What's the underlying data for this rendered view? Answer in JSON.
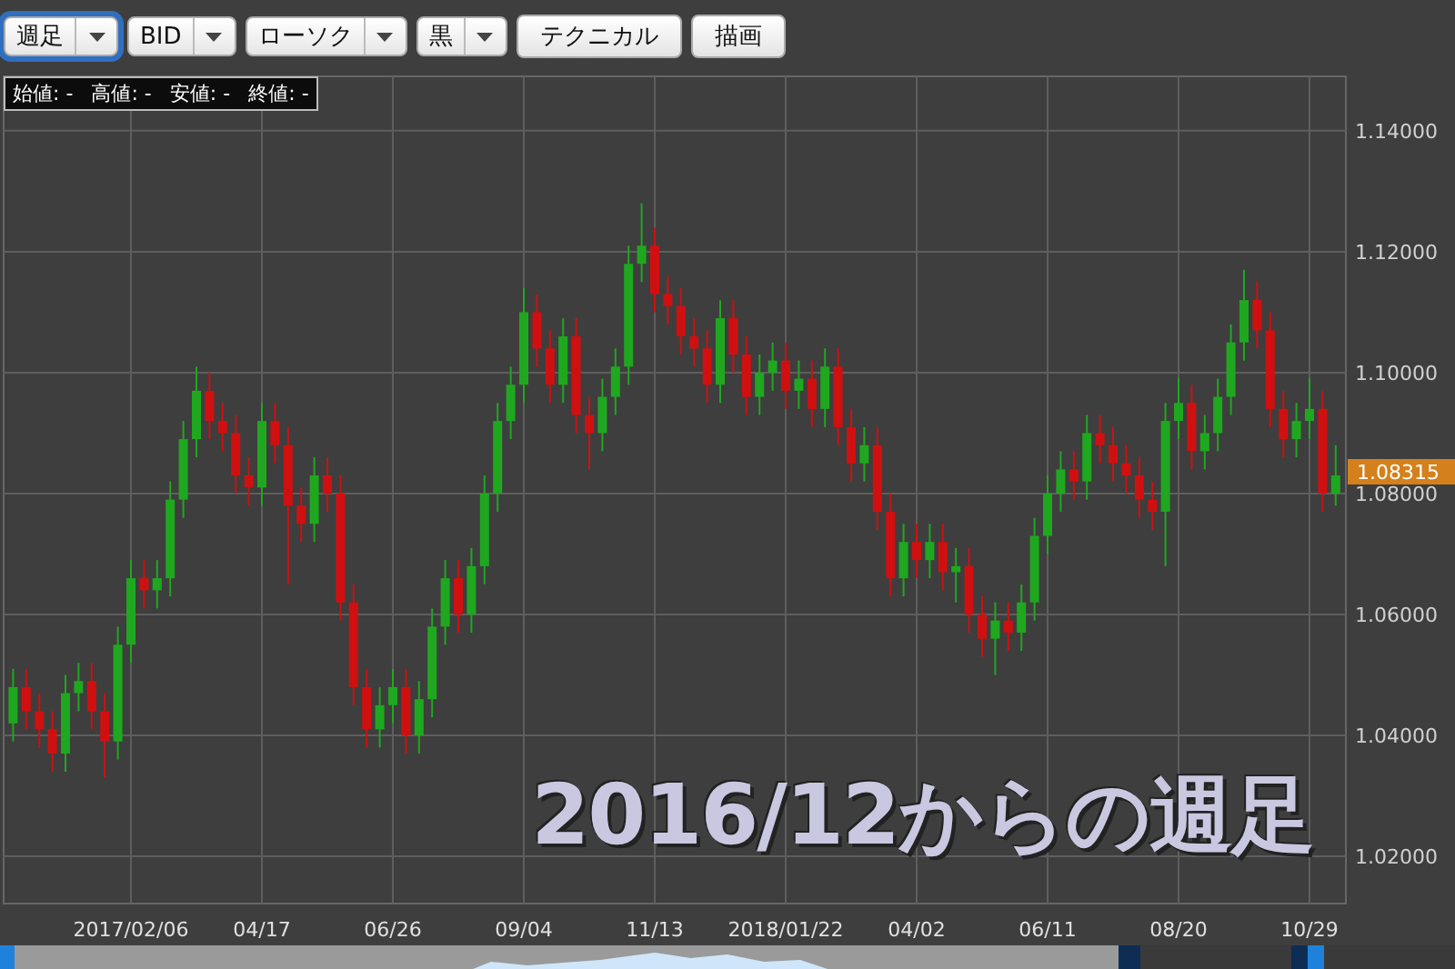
{
  "toolbar": {
    "selects": [
      {
        "value": "週足",
        "focused": true
      },
      {
        "value": "BID",
        "focused": false
      },
      {
        "value": "ローソク",
        "focused": false
      },
      {
        "value": "黒",
        "focused": false
      }
    ],
    "buttons": [
      "テクニカル",
      "描画"
    ]
  },
  "ohlc_legend": [
    {
      "label": "始値:",
      "value": "-"
    },
    {
      "label": "高値:",
      "value": "-"
    },
    {
      "label": "安値:",
      "value": "-"
    },
    {
      "label": "終値:",
      "value": "-"
    }
  ],
  "chart": {
    "current_price": "1.08315",
    "chart_data": {
      "type": "candlestick",
      "categories": [
        null,
        null,
        null,
        null,
        null,
        null,
        null,
        null,
        null,
        "2017/02/06",
        null,
        null,
        null,
        null,
        null,
        null,
        null,
        null,
        null,
        "04/17",
        null,
        null,
        null,
        null,
        null,
        null,
        null,
        null,
        null,
        "06/26",
        null,
        null,
        null,
        null,
        null,
        null,
        null,
        null,
        null,
        "09/04",
        null,
        null,
        null,
        null,
        null,
        null,
        null,
        null,
        null,
        "11/13",
        null,
        null,
        null,
        null,
        null,
        null,
        null,
        null,
        null,
        "2018/01/22",
        null,
        null,
        null,
        null,
        null,
        null,
        null,
        null,
        null,
        "04/02",
        null,
        null,
        null,
        null,
        null,
        null,
        null,
        null,
        null,
        "06/11",
        null,
        null,
        null,
        null,
        null,
        null,
        null,
        null,
        null,
        "08/20",
        null,
        null,
        null,
        null,
        null,
        null,
        null,
        null,
        null,
        "10/29",
        null,
        null
      ],
      "ohlc": [
        [
          1.042,
          1.051,
          1.039,
          1.048
        ],
        [
          1.048,
          1.051,
          1.041,
          1.044
        ],
        [
          1.044,
          1.047,
          1.038,
          1.041
        ],
        [
          1.041,
          1.044,
          1.034,
          1.037
        ],
        [
          1.037,
          1.05,
          1.034,
          1.047
        ],
        [
          1.047,
          1.052,
          1.044,
          1.049
        ],
        [
          1.049,
          1.052,
          1.041,
          1.044
        ],
        [
          1.044,
          1.047,
          1.033,
          1.039
        ],
        [
          1.039,
          1.058,
          1.036,
          1.055
        ],
        [
          1.055,
          1.069,
          1.052,
          1.066
        ],
        [
          1.066,
          1.069,
          1.061,
          1.064
        ],
        [
          1.064,
          1.069,
          1.061,
          1.066
        ],
        [
          1.066,
          1.082,
          1.063,
          1.079
        ],
        [
          1.079,
          1.092,
          1.076,
          1.089
        ],
        [
          1.089,
          1.101,
          1.086,
          1.097
        ],
        [
          1.097,
          1.1,
          1.089,
          1.092
        ],
        [
          1.092,
          1.095,
          1.087,
          1.09
        ],
        [
          1.09,
          1.093,
          1.08,
          1.083
        ],
        [
          1.083,
          1.086,
          1.078,
          1.081
        ],
        [
          1.081,
          1.095,
          1.078,
          1.092
        ],
        [
          1.092,
          1.095,
          1.085,
          1.088
        ],
        [
          1.088,
          1.091,
          1.065,
          1.078
        ],
        [
          1.078,
          1.081,
          1.072,
          1.075
        ],
        [
          1.075,
          1.086,
          1.072,
          1.083
        ],
        [
          1.083,
          1.086,
          1.077,
          1.08
        ],
        [
          1.08,
          1.083,
          1.059,
          1.062
        ],
        [
          1.062,
          1.065,
          1.045,
          1.048
        ],
        [
          1.048,
          1.051,
          1.038,
          1.041
        ],
        [
          1.041,
          1.048,
          1.038,
          1.045
        ],
        [
          1.045,
          1.051,
          1.042,
          1.048
        ],
        [
          1.048,
          1.051,
          1.037,
          1.04
        ],
        [
          1.04,
          1.049,
          1.037,
          1.046
        ],
        [
          1.046,
          1.061,
          1.043,
          1.058
        ],
        [
          1.058,
          1.069,
          1.055,
          1.066
        ],
        [
          1.066,
          1.069,
          1.057,
          1.06
        ],
        [
          1.06,
          1.071,
          1.057,
          1.068
        ],
        [
          1.068,
          1.083,
          1.065,
          1.08
        ],
        [
          1.08,
          1.095,
          1.077,
          1.092
        ],
        [
          1.092,
          1.101,
          1.089,
          1.098
        ],
        [
          1.098,
          1.114,
          1.095,
          1.11
        ],
        [
          1.11,
          1.113,
          1.101,
          1.104
        ],
        [
          1.104,
          1.107,
          1.095,
          1.098
        ],
        [
          1.098,
          1.109,
          1.095,
          1.106
        ],
        [
          1.106,
          1.109,
          1.09,
          1.093
        ],
        [
          1.093,
          1.096,
          1.084,
          1.09
        ],
        [
          1.09,
          1.099,
          1.087,
          1.096
        ],
        [
          1.096,
          1.104,
          1.093,
          1.101
        ],
        [
          1.101,
          1.121,
          1.098,
          1.118
        ],
        [
          1.118,
          1.128,
          1.115,
          1.121
        ],
        [
          1.121,
          1.124,
          1.11,
          1.113
        ],
        [
          1.113,
          1.116,
          1.108,
          1.111
        ],
        [
          1.111,
          1.114,
          1.103,
          1.106
        ],
        [
          1.106,
          1.109,
          1.101,
          1.104
        ],
        [
          1.104,
          1.107,
          1.095,
          1.098
        ],
        [
          1.098,
          1.112,
          1.095,
          1.109
        ],
        [
          1.109,
          1.112,
          1.1,
          1.103
        ],
        [
          1.103,
          1.106,
          1.093,
          1.096
        ],
        [
          1.096,
          1.103,
          1.093,
          1.1
        ],
        [
          1.1,
          1.105,
          1.097,
          1.102
        ],
        [
          1.102,
          1.105,
          1.094,
          1.097
        ],
        [
          1.097,
          1.102,
          1.094,
          1.099
        ],
        [
          1.099,
          1.102,
          1.091,
          1.094
        ],
        [
          1.094,
          1.104,
          1.091,
          1.101
        ],
        [
          1.101,
          1.104,
          1.088,
          1.091
        ],
        [
          1.091,
          1.094,
          1.082,
          1.085
        ],
        [
          1.085,
          1.091,
          1.082,
          1.088
        ],
        [
          1.088,
          1.091,
          1.074,
          1.077
        ],
        [
          1.077,
          1.08,
          1.063,
          1.066
        ],
        [
          1.066,
          1.075,
          1.063,
          1.072
        ],
        [
          1.072,
          1.075,
          1.066,
          1.069
        ],
        [
          1.069,
          1.075,
          1.066,
          1.072
        ],
        [
          1.072,
          1.075,
          1.064,
          1.067
        ],
        [
          1.067,
          1.071,
          1.062,
          1.068
        ],
        [
          1.068,
          1.071,
          1.057,
          1.06
        ],
        [
          1.06,
          1.063,
          1.053,
          1.056
        ],
        [
          1.056,
          1.062,
          1.05,
          1.059
        ],
        [
          1.059,
          1.062,
          1.054,
          1.057
        ],
        [
          1.057,
          1.065,
          1.054,
          1.062
        ],
        [
          1.062,
          1.076,
          1.059,
          1.073
        ],
        [
          1.073,
          1.083,
          1.07,
          1.08
        ],
        [
          1.08,
          1.087,
          1.077,
          1.084
        ],
        [
          1.084,
          1.087,
          1.079,
          1.082
        ],
        [
          1.082,
          1.093,
          1.079,
          1.09
        ],
        [
          1.09,
          1.093,
          1.085,
          1.088
        ],
        [
          1.088,
          1.091,
          1.082,
          1.085
        ],
        [
          1.085,
          1.088,
          1.08,
          1.083
        ],
        [
          1.083,
          1.086,
          1.076,
          1.079
        ],
        [
          1.079,
          1.082,
          1.074,
          1.077
        ],
        [
          1.077,
          1.095,
          1.068,
          1.092
        ],
        [
          1.092,
          1.099,
          1.089,
          1.095
        ],
        [
          1.095,
          1.098,
          1.084,
          1.087
        ],
        [
          1.087,
          1.093,
          1.084,
          1.09
        ],
        [
          1.09,
          1.099,
          1.087,
          1.096
        ],
        [
          1.096,
          1.108,
          1.093,
          1.105
        ],
        [
          1.105,
          1.117,
          1.102,
          1.112
        ],
        [
          1.112,
          1.115,
          1.104,
          1.107
        ],
        [
          1.107,
          1.11,
          1.091,
          1.094
        ],
        [
          1.094,
          1.097,
          1.086,
          1.089
        ],
        [
          1.089,
          1.095,
          1.086,
          1.092
        ],
        [
          1.092,
          1.099,
          1.089,
          1.094
        ],
        [
          1.094,
          1.097,
          1.077,
          1.08
        ],
        [
          1.08,
          1.088,
          1.078,
          1.083
        ]
      ],
      "ylim": [
        1.0122,
        1.149
      ],
      "grid": true,
      "yticks": [
        {
          "value": 1.14,
          "label": "1.14000"
        },
        {
          "value": 1.12,
          "label": "1.12000"
        },
        {
          "value": 1.1,
          "label": "1.10000"
        },
        {
          "value": 1.08,
          "label": "1.08000"
        },
        {
          "value": 1.06,
          "label": "1.06000"
        },
        {
          "value": 1.04,
          "label": "1.04000"
        },
        {
          "value": 1.02,
          "label": "1.02000"
        }
      ]
    }
  },
  "overlay_caption": "2016/12からの週足"
}
